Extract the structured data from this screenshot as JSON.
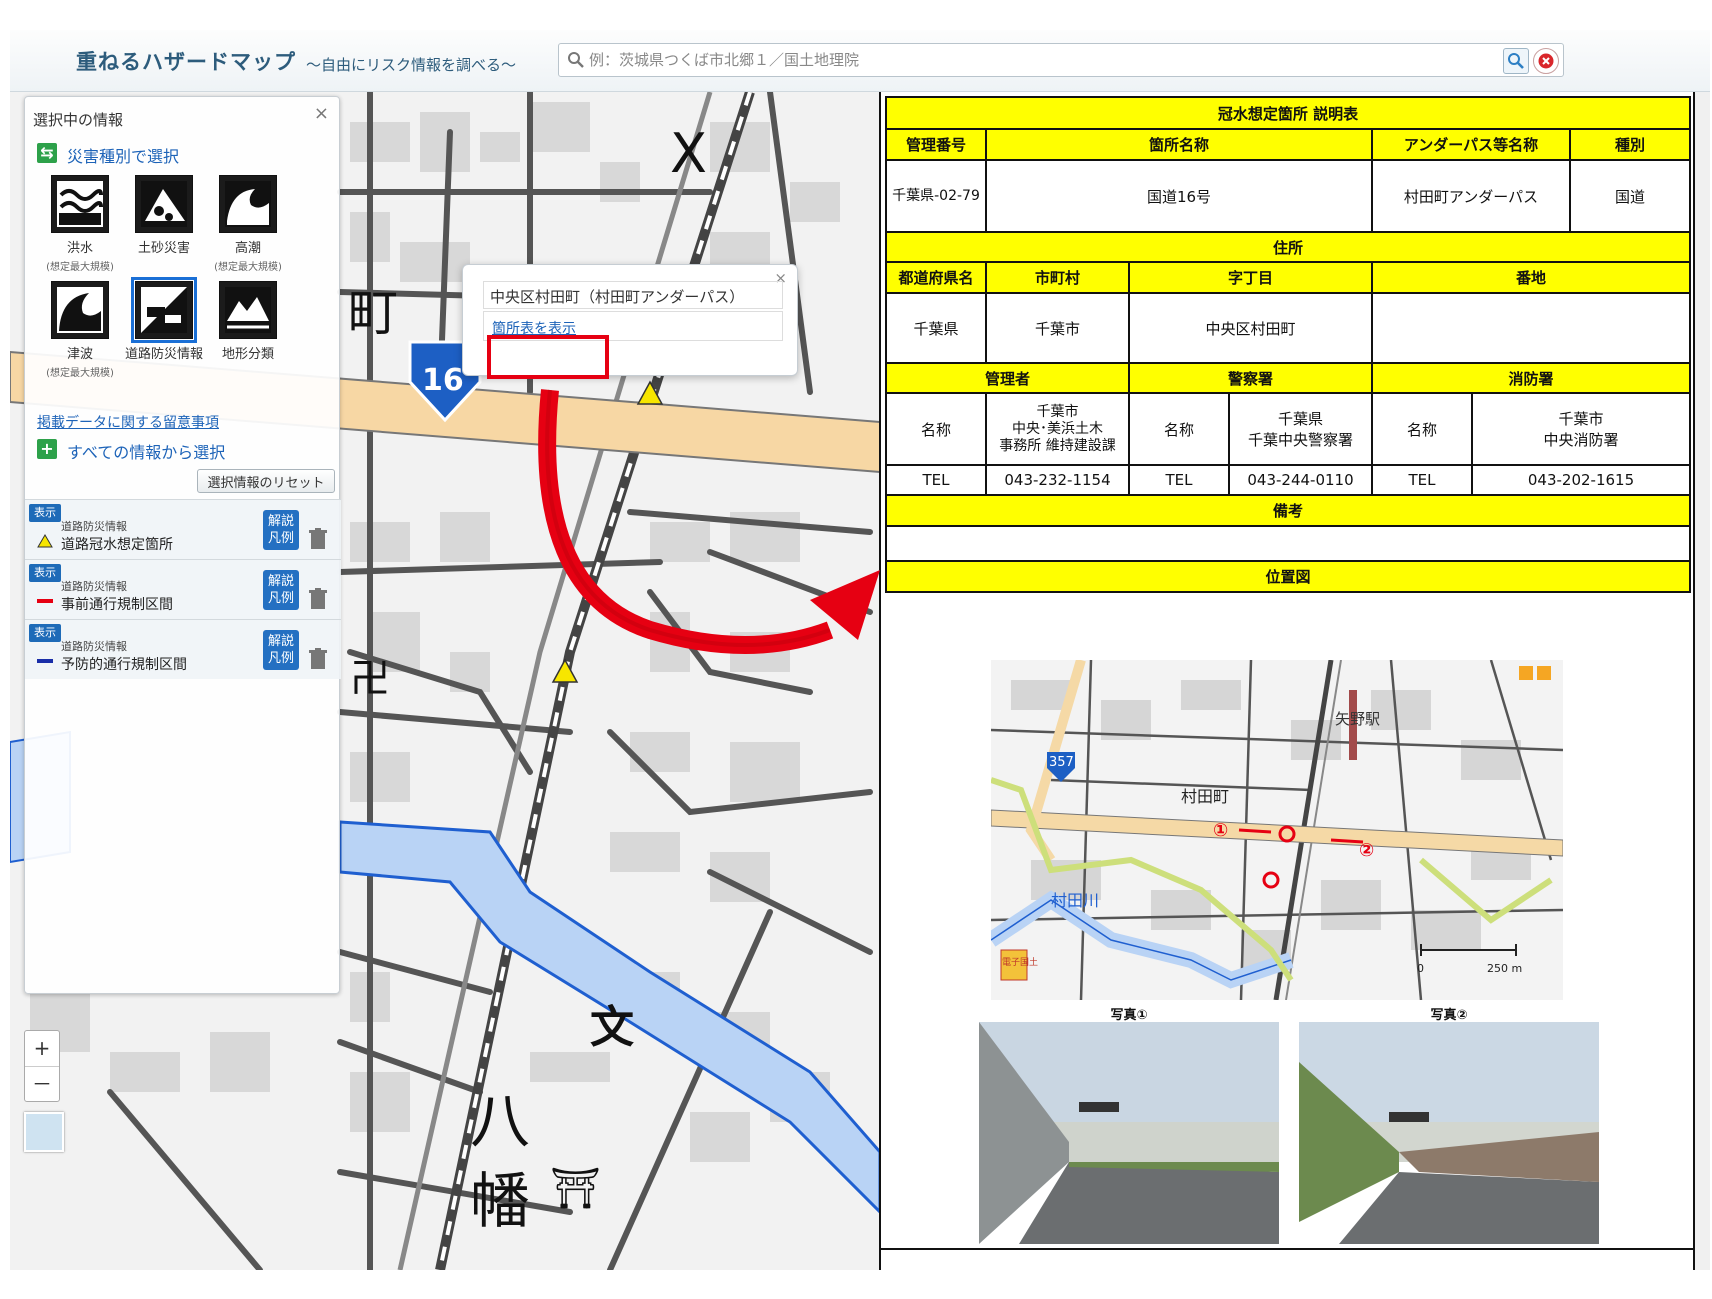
{
  "header": {
    "title": "重ねるハザードマップ",
    "subtitle": "～自由にリスク情報を調べる～",
    "search_placeholder": "例：茨城県つくば市北郷１／国土地理院"
  },
  "panel": {
    "title": "選択中の情報",
    "close": "×",
    "by_disaster_label": "災害種別で選択",
    "hazards": [
      {
        "label": "洪水",
        "sub": "(想定最大規模)"
      },
      {
        "label": "土砂災害",
        "sub": ""
      },
      {
        "label": "高潮",
        "sub": "(想定最大規模)"
      },
      {
        "label": "津波",
        "sub": "(想定最大規模)"
      },
      {
        "label": "道路防災情報",
        "sub": ""
      },
      {
        "label": "地形分類",
        "sub": ""
      }
    ],
    "notes_link": "掲載データに関する留意事項",
    "all_info_label": "すべての情報から選択",
    "reset_label": "選択情報のリセット",
    "layers": [
      {
        "show": "表示",
        "category": "道路防災情報",
        "name": "道路冠水想定箇所",
        "legend": "解説\n凡例"
      },
      {
        "show": "表示",
        "category": "道路防災情報",
        "name": "事前通行規制区間",
        "legend": "解説\n凡例"
      },
      {
        "show": "表示",
        "category": "道路防災情報",
        "name": "予防的通行規制区間",
        "legend": "解説\n凡例"
      }
    ]
  },
  "zoom": {
    "in": "+",
    "out": "－"
  },
  "popup": {
    "title": "中央区村田町（村田町アンダーパス）",
    "link": "箇所表を表示",
    "close": "×"
  },
  "map_labels": {
    "town": "町",
    "route": "16",
    "hachi": "八",
    "man": "幡"
  },
  "doc": {
    "title": "冠水想定箇所 説明表",
    "col_id": "管理番号",
    "col_name": "箇所名称",
    "col_underpass": "アンダーパス等名称",
    "col_type": "種別",
    "id": "千葉県-02-79",
    "name": "国道16号",
    "underpass": "村田町アンダーパス",
    "type": "国道",
    "address_label": "住所",
    "pref_label": "都道府県名",
    "city_label": "市町村",
    "district_label": "字丁目",
    "lot_label": "番地",
    "pref": "千葉県",
    "city": "千葉市",
    "district": "中央区村田町",
    "lot": "",
    "manager_label": "管理者",
    "police_label": "警察署",
    "fire_label": "消防署",
    "name_label": "名称",
    "tel_label": "TEL",
    "manager_name_1": "千葉市",
    "manager_name_2": "中央･美浜土木",
    "manager_name_3": "事務所 維持建設課",
    "police_name_1": "千葉県",
    "police_name_2": "千葉中央警察署",
    "fire_name_1": "千葉市",
    "fire_name_2": "中央消防署",
    "manager_tel": "043-232-1154",
    "police_tel": "043-244-0110",
    "fire_tel": "043-202-1615",
    "remarks_label": "備考",
    "remarks": "",
    "location_label": "位置図",
    "loc_map": {
      "station": "矢野駅",
      "town": "村田町",
      "river": "村田川",
      "route": "357",
      "p1": "①",
      "p2": "②",
      "scale_0": "0",
      "scale_250": "250 m",
      "stamp": "電子国土"
    },
    "photo1_caption": "写真①",
    "photo2_caption": "写真②"
  },
  "colors": {
    "header_yellow": "#ffff00",
    "link_blue": "#1d63b8",
    "highlight_red": "#e60012",
    "river_blue": "#b9d3f5",
    "road_orange": "#f7d7a4"
  }
}
